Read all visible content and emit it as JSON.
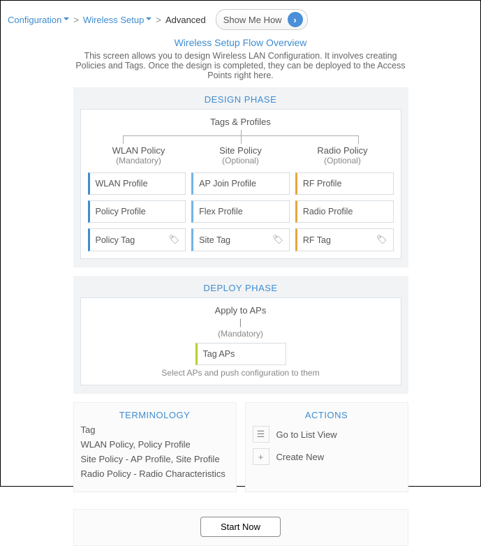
{
  "breadcrumb": {
    "item1": "Configuration",
    "item2": "Wireless Setup",
    "current": "Advanced"
  },
  "show_me_how": "Show Me How",
  "overview": {
    "title": "Wireless Setup Flow Overview",
    "intro": "This screen allows you to design Wireless LAN Configuration. It involves creating Policies and Tags. Once the design is completed, they can be deployed to the Access Points right here."
  },
  "design": {
    "heading": "DESIGN PHASE",
    "root": "Tags & Profiles",
    "cols": {
      "wlan": {
        "label": "WLAN Policy",
        "note": "(Mandatory)"
      },
      "site": {
        "label": "Site Policy",
        "note": "(Optional)"
      },
      "radio": {
        "label": "Radio Policy",
        "note": "(Optional)"
      }
    },
    "chips": {
      "wlan_profile": "WLAN Profile",
      "ap_join_profile": "AP Join Profile",
      "rf_profile": "RF Profile",
      "policy_profile": "Policy Profile",
      "flex_profile": "Flex Profile",
      "radio_profile": "Radio Profile",
      "policy_tag": "Policy Tag",
      "site_tag": "Site Tag",
      "rf_tag": "RF Tag"
    }
  },
  "deploy": {
    "heading": "DEPLOY PHASE",
    "root": "Apply to APs",
    "note": "(Mandatory)",
    "chip": "Tag APs",
    "sub": "Select APs and push configuration to them"
  },
  "terminology": {
    "heading": "TERMINOLOGY",
    "items": [
      "Tag",
      "WLAN Policy, Policy Profile",
      "Site Policy - AP Profile, Site Profile",
      "Radio Policy - Radio Characteristics"
    ]
  },
  "actions": {
    "heading": "ACTIONS",
    "list_view": "Go to List View",
    "create_new": "Create New"
  },
  "start": "Start Now"
}
